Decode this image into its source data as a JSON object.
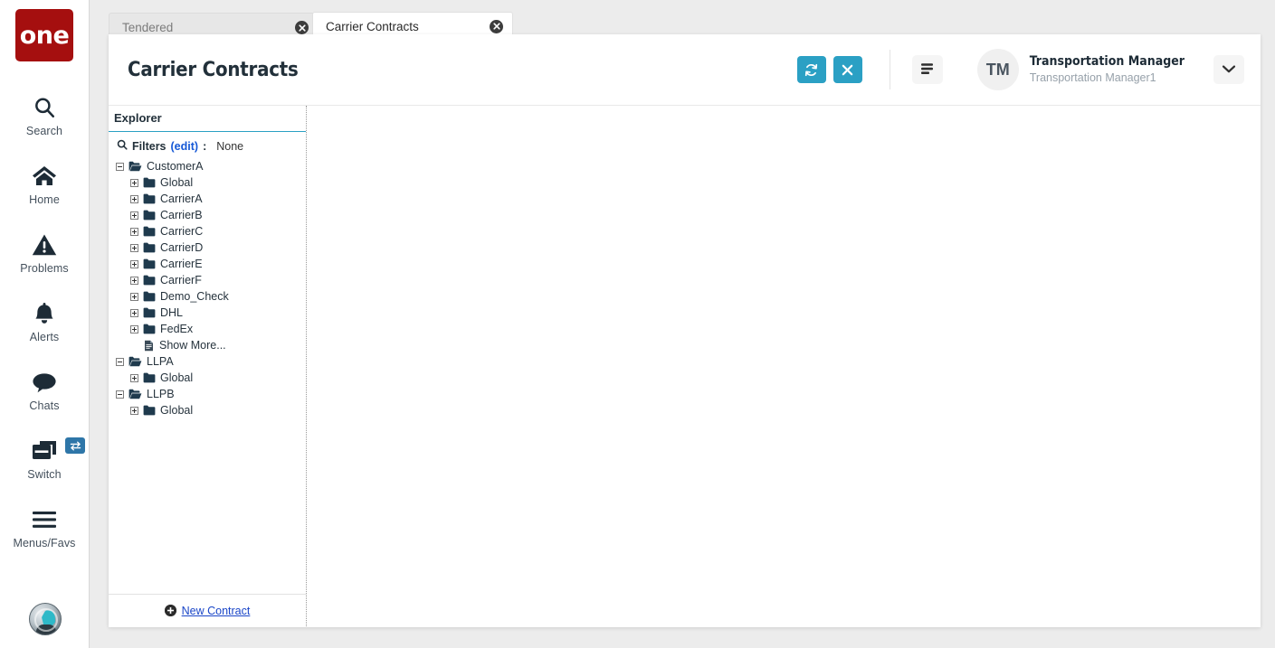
{
  "brand": {
    "logo_text": "one",
    "logo_color": "#a50f0f"
  },
  "accent": {
    "teal": "#2ba0c4",
    "link_blue": "#1a46c8",
    "badge_blue": "#2e76a8"
  },
  "rail": {
    "items": [
      {
        "label": "Search",
        "icon": "search-icon"
      },
      {
        "label": "Home",
        "icon": "home-icon"
      },
      {
        "label": "Problems",
        "icon": "warning-triangle-icon"
      },
      {
        "label": "Alerts",
        "icon": "bell-icon"
      },
      {
        "label": "Chats",
        "icon": "chat-bubble-icon"
      },
      {
        "label": "Switch",
        "icon": "switch-windows-icon",
        "badge_icon": "swap-arrows-icon"
      },
      {
        "label": "Menus/Favs",
        "icon": "hamburger-icon"
      }
    ],
    "assistant_icon": "ai-assistant-avatar"
  },
  "tabs": [
    {
      "label": "Tendered",
      "active": false,
      "close_icon": "close-circle-icon"
    },
    {
      "label": "Carrier Contracts",
      "active": true,
      "close_icon": "close-circle-icon"
    }
  ],
  "header": {
    "title": "Carrier Contracts",
    "actions": [
      {
        "name": "refresh-button",
        "icon": "refresh-icon"
      },
      {
        "name": "close-button",
        "icon": "x-icon"
      }
    ],
    "menu_button_icon": "list-menu-icon",
    "user": {
      "initials": "TM",
      "name": "Transportation Manager",
      "role": "Transportation Manager1"
    },
    "caret_icon": "chevron-down-icon"
  },
  "explorer": {
    "title": "Explorer",
    "filters": {
      "search_icon": "search-icon",
      "label": "Filters",
      "edit_label": "(edit)",
      "colon": ":",
      "value": "None"
    },
    "tree": [
      {
        "label": "CustomerA",
        "level": 0,
        "state": "expanded",
        "icon": "folder-open-icon"
      },
      {
        "label": "Global",
        "level": 1,
        "state": "collapsed",
        "icon": "folder-icon"
      },
      {
        "label": "CarrierA",
        "level": 1,
        "state": "collapsed",
        "icon": "folder-icon"
      },
      {
        "label": "CarrierB",
        "level": 1,
        "state": "collapsed",
        "icon": "folder-icon"
      },
      {
        "label": "CarrierC",
        "level": 1,
        "state": "collapsed",
        "icon": "folder-icon"
      },
      {
        "label": "CarrierD",
        "level": 1,
        "state": "collapsed",
        "icon": "folder-icon"
      },
      {
        "label": "CarrierE",
        "level": 1,
        "state": "collapsed",
        "icon": "folder-icon"
      },
      {
        "label": "CarrierF",
        "level": 1,
        "state": "collapsed",
        "icon": "folder-icon"
      },
      {
        "label": "Demo_Check",
        "level": 1,
        "state": "collapsed",
        "icon": "folder-icon"
      },
      {
        "label": "DHL",
        "level": 1,
        "state": "collapsed",
        "icon": "folder-icon"
      },
      {
        "label": "FedEx",
        "level": 1,
        "state": "collapsed",
        "icon": "folder-icon"
      },
      {
        "label": "Show More...",
        "level": 1,
        "state": "leaf",
        "icon": "document-icon"
      },
      {
        "label": "LLPA",
        "level": 0,
        "state": "expanded",
        "icon": "folder-open-icon"
      },
      {
        "label": "Global",
        "level": 1,
        "state": "collapsed",
        "icon": "folder-icon"
      },
      {
        "label": "LLPB",
        "level": 0,
        "state": "expanded",
        "icon": "folder-open-icon"
      },
      {
        "label": "Global",
        "level": 1,
        "state": "collapsed",
        "icon": "folder-icon"
      }
    ],
    "footer": {
      "icon": "plus-circle-icon",
      "label": "New Contract"
    }
  },
  "main": {
    "content": ""
  }
}
